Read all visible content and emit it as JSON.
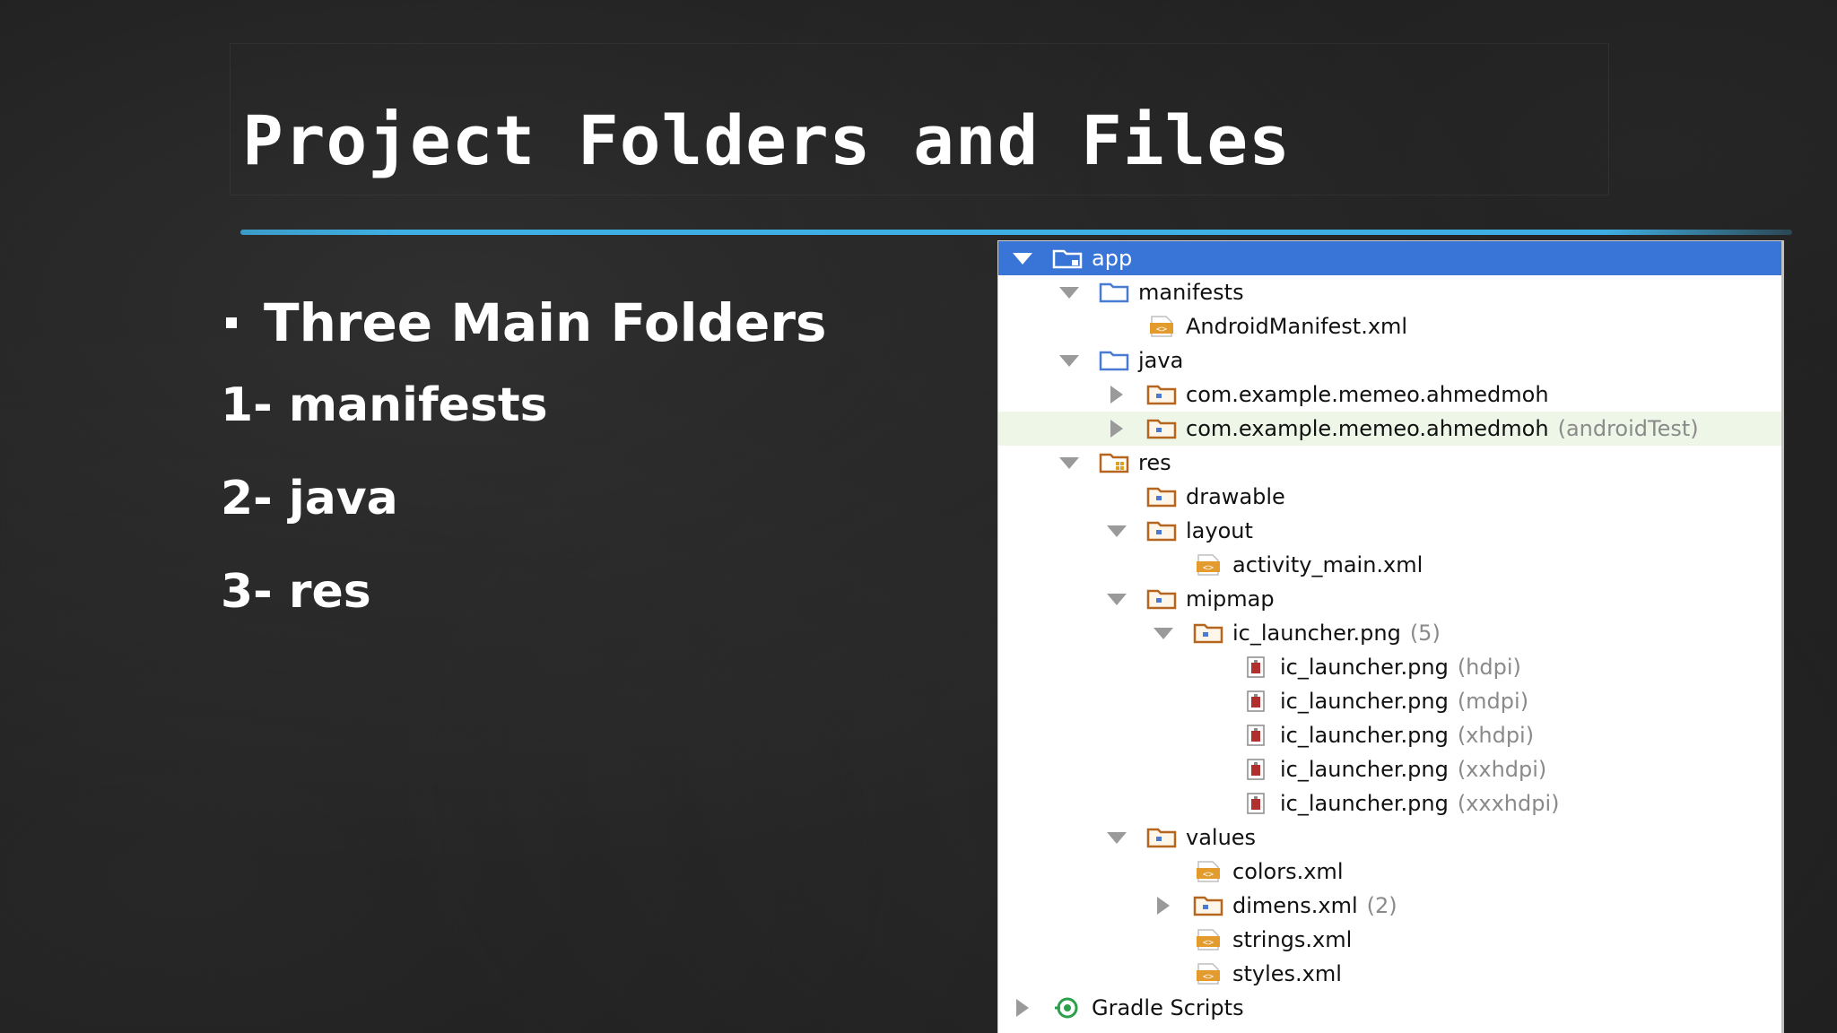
{
  "slide": {
    "title": "Project Folders and Files",
    "bullet_main": "Three Main Folders",
    "items": [
      "1- manifests",
      "2- java",
      "3- res"
    ]
  },
  "colors": {
    "accent_rule": "#3eafe3",
    "selection": "#3875d7",
    "folder": "#4a7bd2",
    "package_folder": "#b5651d",
    "xml_file": "#e39b2d",
    "png_file": "#b03030",
    "gradle": "#2aa04a"
  },
  "tree": [
    {
      "arrow": "down",
      "icon": "module-folder-icon",
      "label": "app",
      "hint": "",
      "selected": true
    },
    {
      "arrow": "down",
      "icon": "folder-icon",
      "label": "manifests",
      "hint": ""
    },
    {
      "arrow": "none",
      "icon": "xml-file-icon",
      "label": "AndroidManifest.xml",
      "hint": ""
    },
    {
      "arrow": "down",
      "icon": "folder-icon",
      "label": "java",
      "hint": ""
    },
    {
      "arrow": "right",
      "icon": "package-icon",
      "label": "com.example.memeo.ahmedmoh",
      "hint": ""
    },
    {
      "arrow": "right",
      "icon": "package-icon",
      "label": "com.example.memeo.ahmedmoh",
      "hint": "(androidTest)",
      "hover": true
    },
    {
      "arrow": "down",
      "icon": "res-folder-icon",
      "label": "res",
      "hint": ""
    },
    {
      "arrow": "none",
      "icon": "package-icon",
      "label": "drawable",
      "hint": ""
    },
    {
      "arrow": "down",
      "icon": "package-icon",
      "label": "layout",
      "hint": ""
    },
    {
      "arrow": "none",
      "icon": "xml-file-icon",
      "label": "activity_main.xml",
      "hint": ""
    },
    {
      "arrow": "down",
      "icon": "package-icon",
      "label": "mipmap",
      "hint": ""
    },
    {
      "arrow": "down",
      "icon": "package-icon",
      "label": "ic_launcher.png",
      "hint": "(5)"
    },
    {
      "arrow": "none",
      "icon": "png-file-icon",
      "label": "ic_launcher.png",
      "hint": "(hdpi)"
    },
    {
      "arrow": "none",
      "icon": "png-file-icon",
      "label": "ic_launcher.png",
      "hint": "(mdpi)"
    },
    {
      "arrow": "none",
      "icon": "png-file-icon",
      "label": "ic_launcher.png",
      "hint": "(xhdpi)"
    },
    {
      "arrow": "none",
      "icon": "png-file-icon",
      "label": "ic_launcher.png",
      "hint": "(xxhdpi)"
    },
    {
      "arrow": "none",
      "icon": "png-file-icon",
      "label": "ic_launcher.png",
      "hint": "(xxxhdpi)"
    },
    {
      "arrow": "down",
      "icon": "package-icon",
      "label": "values",
      "hint": ""
    },
    {
      "arrow": "none",
      "icon": "xml-file-icon",
      "label": "colors.xml",
      "hint": ""
    },
    {
      "arrow": "right",
      "icon": "package-icon",
      "label": "dimens.xml",
      "hint": "(2)"
    },
    {
      "arrow": "none",
      "icon": "xml-file-icon",
      "label": "strings.xml",
      "hint": ""
    },
    {
      "arrow": "none",
      "icon": "xml-file-icon",
      "label": "styles.xml",
      "hint": ""
    },
    {
      "arrow": "right",
      "icon": "gradle-icon",
      "label": "Gradle Scripts",
      "hint": ""
    }
  ]
}
